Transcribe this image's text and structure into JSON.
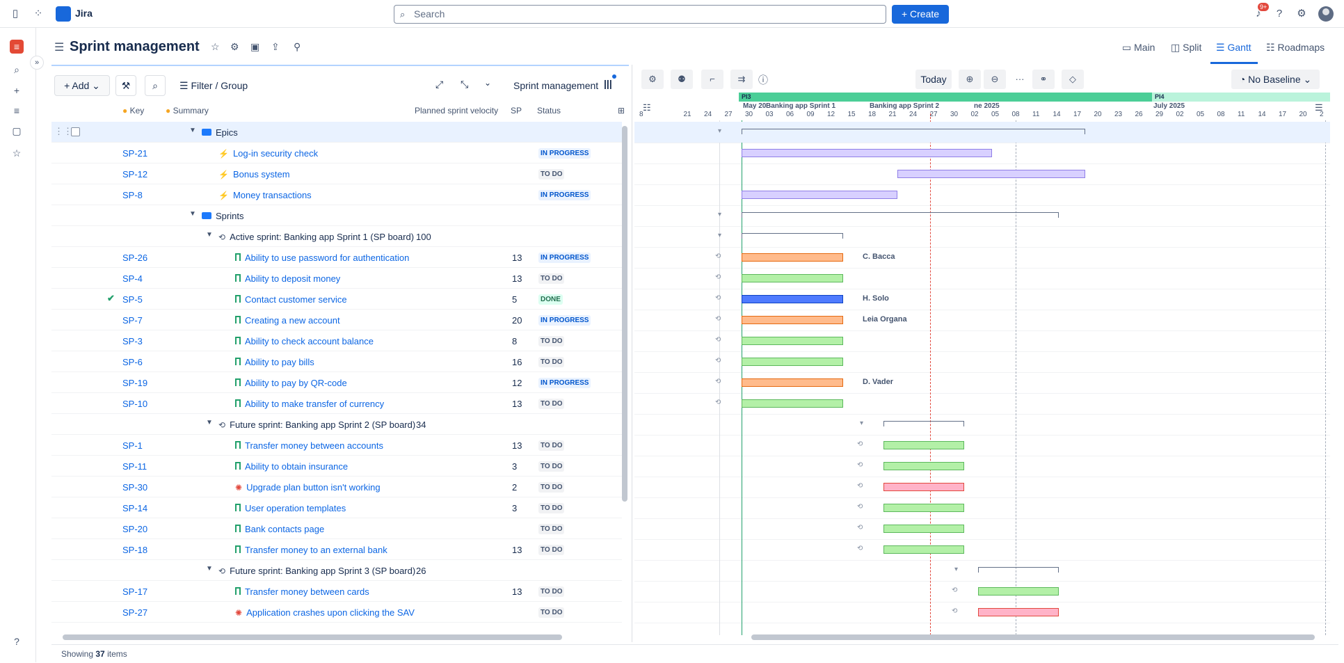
{
  "app": {
    "name": "Jira"
  },
  "topbar": {
    "search_placeholder": "Search",
    "create_label": "Create",
    "notifications_badge": "9+"
  },
  "page": {
    "title": "Sprint management"
  },
  "views": [
    "Main",
    "Split",
    "Gantt",
    "Roadmaps"
  ],
  "active_view": "Gantt",
  "toolbar": {
    "add_label": "Add",
    "filter_label": "Filter / Group",
    "board_label": "Sprint management"
  },
  "columns": {
    "key": "Key",
    "summary": "Summary",
    "velocity": "Planned sprint velocity",
    "sp": "SP",
    "status": "Status"
  },
  "rows": [
    {
      "type": "group",
      "icon": "folder",
      "summary": "Epics",
      "level": 1
    },
    {
      "type": "epic",
      "key": "SP-21",
      "summary": "Log-in security check",
      "status": "IN PROGRESS"
    },
    {
      "type": "epic",
      "key": "SP-12",
      "summary": "Bonus system",
      "status": "TO DO"
    },
    {
      "type": "epic",
      "key": "SP-8",
      "summary": "Money transactions",
      "status": "IN PROGRESS"
    },
    {
      "type": "group",
      "icon": "folder",
      "summary": "Sprints",
      "level": 1
    },
    {
      "type": "sprint",
      "summary": "Active sprint: Banking app Sprint 1 (SP board)",
      "velocity": "100"
    },
    {
      "type": "story",
      "key": "SP-26",
      "summary": "Ability to use password for authentication",
      "sp": "13",
      "status": "IN PROGRESS"
    },
    {
      "type": "story",
      "key": "SP-4",
      "summary": "Ability to deposit money",
      "sp": "13",
      "status": "TO DO"
    },
    {
      "type": "story",
      "key": "SP-5",
      "summary": "Contact customer service",
      "sp": "5",
      "status": "DONE",
      "done": true
    },
    {
      "type": "story",
      "key": "SP-7",
      "summary": "Creating a new account",
      "sp": "20",
      "status": "IN PROGRESS"
    },
    {
      "type": "story",
      "key": "SP-3",
      "summary": "Ability to check account balance",
      "sp": "8",
      "status": "TO DO"
    },
    {
      "type": "story",
      "key": "SP-6",
      "summary": "Ability to pay bills",
      "sp": "16",
      "status": "TO DO"
    },
    {
      "type": "story",
      "key": "SP-19",
      "summary": "Ability to pay by QR-code",
      "sp": "12",
      "status": "IN PROGRESS"
    },
    {
      "type": "story",
      "key": "SP-10",
      "summary": "Ability to make transfer of currency",
      "sp": "13",
      "status": "TO DO"
    },
    {
      "type": "sprint",
      "summary": "Future sprint: Banking app Sprint 2 (SP board)",
      "velocity": "34"
    },
    {
      "type": "story",
      "key": "SP-1",
      "summary": "Transfer money between accounts",
      "sp": "13",
      "status": "TO DO"
    },
    {
      "type": "story",
      "key": "SP-11",
      "summary": "Ability to obtain insurance",
      "sp": "3",
      "status": "TO DO"
    },
    {
      "type": "bug",
      "key": "SP-30",
      "summary": "Upgrade plan button isn't working",
      "sp": "2",
      "status": "TO DO"
    },
    {
      "type": "story",
      "key": "SP-14",
      "summary": "User operation templates",
      "sp": "3",
      "status": "TO DO"
    },
    {
      "type": "story",
      "key": "SP-20",
      "summary": "Bank contacts page",
      "sp": "",
      "status": "TO DO"
    },
    {
      "type": "story",
      "key": "SP-18",
      "summary": "Transfer money to an external bank",
      "sp": "13",
      "status": "TO DO"
    },
    {
      "type": "sprint",
      "summary": "Future sprint: Banking app Sprint 3 (SP board)",
      "velocity": "26"
    },
    {
      "type": "story",
      "key": "SP-17",
      "summary": "Transfer money between cards",
      "sp": "13",
      "status": "TO DO"
    },
    {
      "type": "bug",
      "key": "SP-27",
      "summary": "Application crashes upon clicking the SAV",
      "sp": "",
      "status": "TO DO"
    }
  ],
  "gantt": {
    "today_label": "Today",
    "baseline_label": "No Baseline",
    "program_increments": [
      "PI3",
      "PI4"
    ],
    "months": [
      "May 20",
      "Banking app Sprint 1",
      "Banking app Sprint 2",
      "ne 2025",
      "July 2025"
    ],
    "days": [
      "8",
      "21",
      "24",
      "27",
      "30",
      "03",
      "06",
      "09",
      "12",
      "15",
      "18",
      "21",
      "24",
      "27",
      "30",
      "02",
      "05",
      "08",
      "11",
      "14",
      "17",
      "20",
      "23",
      "26",
      "29",
      "02",
      "05",
      "08",
      "11",
      "14",
      "17",
      "20",
      "2"
    ],
    "assignees": {
      "SP-26": "C. Bacca",
      "SP-5": "H. Solo",
      "SP-7": "Leia Organa",
      "SP-19": "D. Vader"
    }
  },
  "footer": {
    "prefix": "Showing",
    "count": "37",
    "suffix": "items"
  }
}
